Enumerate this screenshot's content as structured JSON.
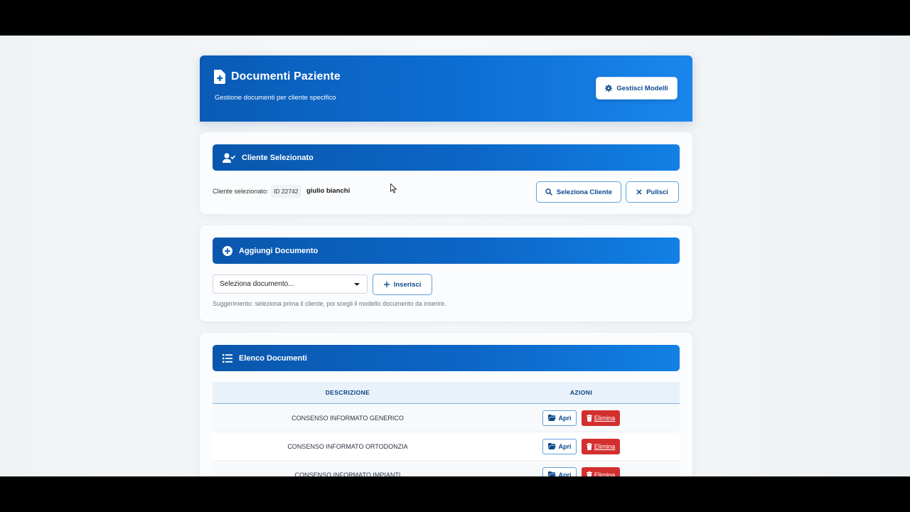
{
  "header": {
    "title": "Documenti Paziente",
    "subtitle": "Gestione documenti per cliente specifico",
    "manage_button": "Gestisci Modelli"
  },
  "client_section": {
    "title": "Cliente Selezionato",
    "selected_label": "Cliente selezionato:",
    "client_id": "ID 22742",
    "client_name": "giulio bianchi",
    "select_button": "Seleziona Cliente",
    "clear_button": "Pulisci"
  },
  "add_section": {
    "title": "Aggiungi Documento",
    "select_value": "Seleziona documento...",
    "insert_button": "Inserisci",
    "hint": "Suggerimento: seleziona prima il cliente, poi scegli il modello documento da inserire."
  },
  "list_section": {
    "title": "Elenco Documenti",
    "columns": [
      "DESCRIZIONE",
      "AZIONI"
    ],
    "open_label": "Apri",
    "delete_label": "Elimina",
    "rows": [
      "CONSENSO INFORMATO GENERICO",
      "CONSENSO INFORMATO ORTODONZIA",
      "CONSENSO INFORMATO IMPIANTI"
    ]
  },
  "colors": {
    "primary": "#0c66c6",
    "danger": "#d32f2f",
    "text_dark": "#0b4a8f"
  }
}
